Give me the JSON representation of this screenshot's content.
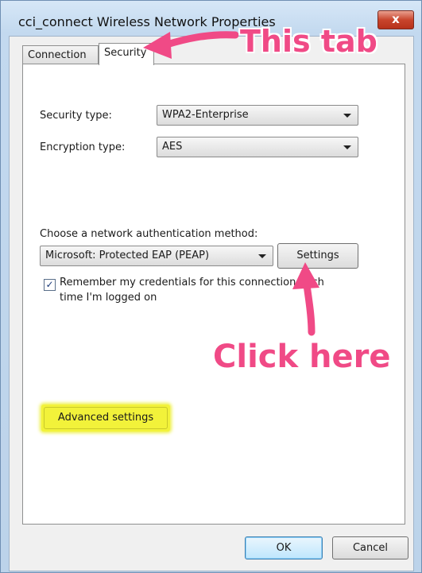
{
  "window": {
    "title": "cci_connect Wireless Network Properties",
    "close_label": "x"
  },
  "tabs": [
    {
      "label": "Connection",
      "selected": false
    },
    {
      "label": "Security",
      "selected": true
    }
  ],
  "security": {
    "security_type_label": "Security type:",
    "security_type_value": "WPA2-Enterprise",
    "encryption_type_label": "Encryption type:",
    "encryption_type_value": "AES",
    "auth_method_label": "Choose a network authentication method:",
    "auth_method_value": "Microsoft: Protected EAP (PEAP)",
    "settings_button": "Settings",
    "remember_checked": true,
    "remember_line1": "Remember my credentials for this connection each",
    "remember_line2": "time I'm logged on",
    "advanced_button": "Advanced settings"
  },
  "footer": {
    "ok_label": "OK",
    "cancel_label": "Cancel"
  },
  "annotations": {
    "tab_callout": "This tab",
    "click_callout": "Click here",
    "callout_color": "#f04a86",
    "highlight_color": "#f2f23a"
  }
}
